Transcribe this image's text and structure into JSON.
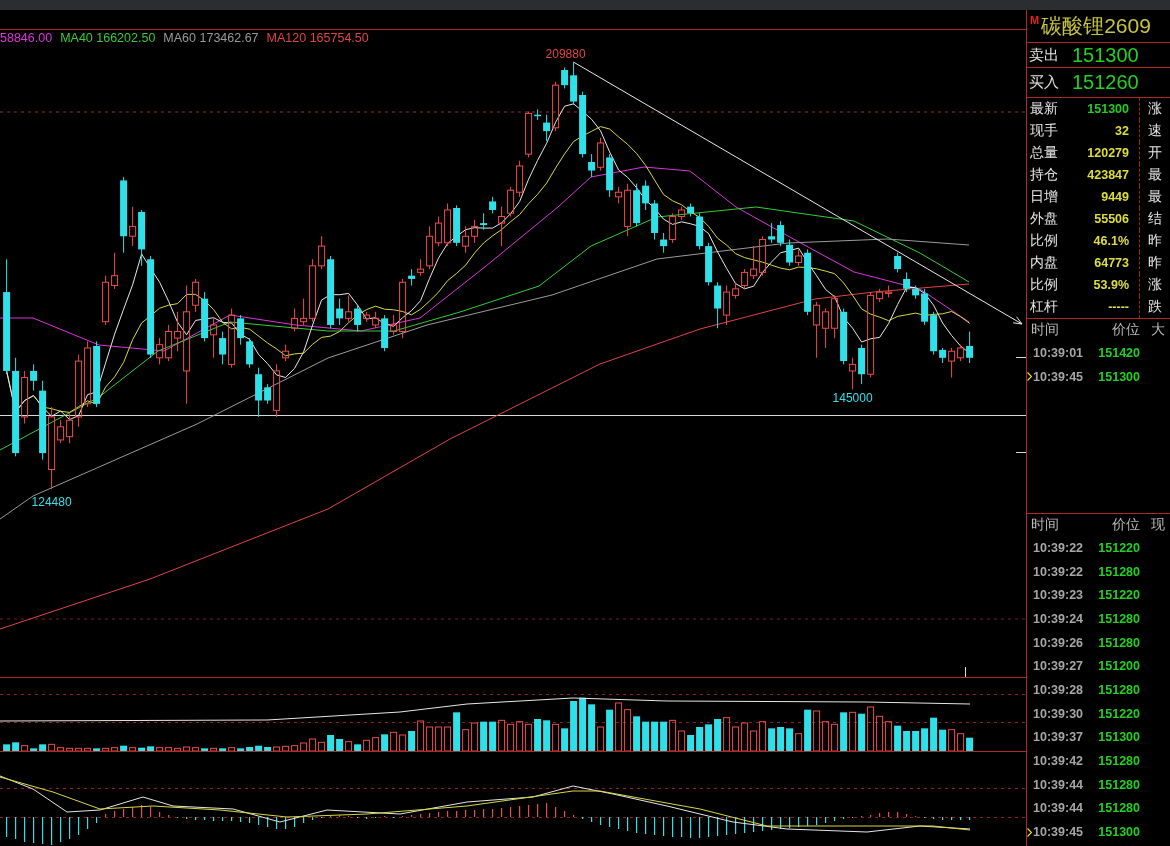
{
  "indicator_legend": [
    {
      "text": "58846.00",
      "color": "#dd33dd"
    },
    {
      "text": "MA40 166202.50",
      "color": "#33cc33"
    },
    {
      "text": "MA60 173462.67",
      "color": "#9a9a9a"
    },
    {
      "text": "MA120 165754.50",
      "color": "#e04444"
    }
  ],
  "price_chart": {
    "high_label": "209880",
    "low_label": "124480",
    "recent_low_label": "145000"
  },
  "quote_panel": {
    "badge": "M",
    "title": "碳酸锂2609",
    "quotes": [
      {
        "label": "卖出",
        "value": "151300"
      },
      {
        "label": "买入",
        "value": "151260"
      }
    ],
    "stats": [
      {
        "label": "最新",
        "value": "151300",
        "color": "#22cc22",
        "side_label": "涨"
      },
      {
        "label": "现手",
        "value": "32",
        "color": "#dede3a",
        "side_label": "速"
      },
      {
        "label": "总量",
        "value": "120279",
        "color": "#dede3a",
        "side_label": "开"
      },
      {
        "label": "持仓",
        "value": "423847",
        "color": "#dede3a",
        "side_label": "最"
      },
      {
        "label": "日增",
        "value": "9449",
        "color": "#dede3a",
        "side_label": "最"
      },
      {
        "label": "外盘",
        "value": "55506",
        "color": "#dede3a",
        "side_label": "结"
      },
      {
        "label": "比例",
        "value": "46.1%",
        "color": "#dede3a",
        "side_label": "昨"
      },
      {
        "label": "内盘",
        "value": "64773",
        "color": "#dede3a",
        "side_label": "昨"
      },
      {
        "label": "比例",
        "value": "53.9%",
        "color": "#dede3a",
        "side_label": "涨"
      },
      {
        "label": "杠杆",
        "value": "-----",
        "color": "#dede3a",
        "side_label": "跌"
      }
    ]
  },
  "tick_lists": [
    {
      "headers": [
        "时间",
        "价位",
        "大"
      ],
      "rows": [
        {
          "time": "10:39:01",
          "price": "151420",
          "current": false
        },
        {
          "time": "10:39:45",
          "price": "151300",
          "current": true
        }
      ]
    },
    {
      "headers": [
        "时间",
        "价位",
        "现"
      ],
      "rows": [
        {
          "time": "10:39:22",
          "price": "151220",
          "current": false
        },
        {
          "time": "10:39:22",
          "price": "151280",
          "current": false
        },
        {
          "time": "10:39:23",
          "price": "151220",
          "current": false
        },
        {
          "time": "10:39:24",
          "price": "151280",
          "current": false
        },
        {
          "time": "10:39:26",
          "price": "151280",
          "current": false
        },
        {
          "time": "10:39:27",
          "price": "151200",
          "current": false
        },
        {
          "time": "10:39:28",
          "price": "151280",
          "current": false
        },
        {
          "time": "10:39:30",
          "price": "151220",
          "current": false
        },
        {
          "time": "10:39:37",
          "price": "151300",
          "current": false
        },
        {
          "time": "10:39:42",
          "price": "151280",
          "current": false
        },
        {
          "time": "10:39:44",
          "price": "151280",
          "current": false
        },
        {
          "time": "10:39:44",
          "price": "151280",
          "current": false
        },
        {
          "time": "10:39:45",
          "price": "151300",
          "current": true
        }
      ]
    }
  ]
}
